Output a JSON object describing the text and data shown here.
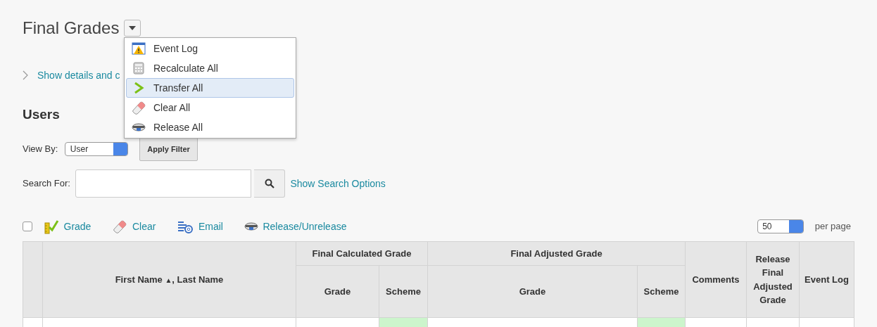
{
  "title": "Final Grades",
  "menu": {
    "items": [
      {
        "label": "Event Log",
        "kind": "warning",
        "selected": false
      },
      {
        "label": "Recalculate All",
        "kind": "calculator",
        "selected": false
      },
      {
        "label": "Transfer All",
        "kind": "chevron",
        "selected": true
      },
      {
        "label": "Clear All",
        "kind": "eraser",
        "selected": false
      },
      {
        "label": "Release All",
        "kind": "release",
        "selected": false
      }
    ]
  },
  "details_link": "Show details and c",
  "section": "Users",
  "view_by": {
    "label": "View By:",
    "value": "User",
    "button": "Apply Filter"
  },
  "search": {
    "label": "Search For:",
    "link": "Show Search Options"
  },
  "toolbar": {
    "select_all_checked": false,
    "actions": [
      {
        "label": "Grade",
        "kind": "grade"
      },
      {
        "label": "Clear",
        "kind": "eraser"
      },
      {
        "label": "Email",
        "kind": "email"
      },
      {
        "label": "Release/Unrelease",
        "kind": "release"
      }
    ],
    "per_page_value": "50",
    "per_page_label": "per page"
  },
  "table": {
    "name_header": "First Name",
    "sort_mark": "▲",
    "name_header_rest": ", Last Name",
    "groups": [
      {
        "label": "Final Calculated Grade",
        "columns": [
          "Grade",
          "Scheme"
        ]
      },
      {
        "label": "Final Adjusted Grade",
        "columns": [
          "Grade",
          "Scheme"
        ]
      }
    ],
    "columns": [
      "Comments",
      "Release Final Adjusted Grade",
      "Event Log"
    ]
  }
}
